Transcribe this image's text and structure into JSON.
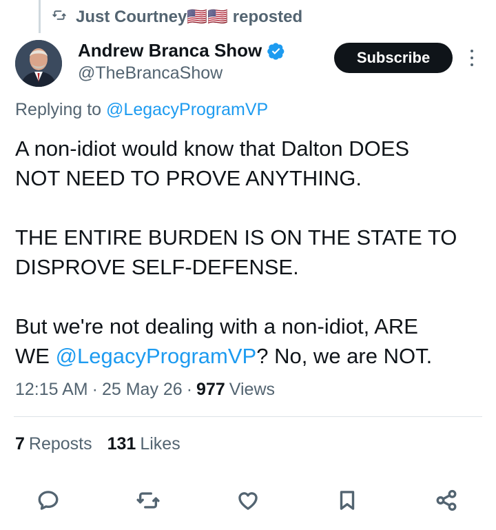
{
  "repost_header": {
    "user": "Just Courtney🇺🇸🇺🇸",
    "action": "reposted"
  },
  "author": {
    "name": "Andrew Branca Show",
    "handle": "@TheBrancaShow",
    "verified": true
  },
  "subscribe_label": "Subscribe",
  "replying": {
    "prefix": "Replying to",
    "mention": "@LegacyProgramVP"
  },
  "tweet": {
    "line1": "A non-idiot would know that Dalton DOES",
    "line2": "NOT NEED TO PROVE ANYTHING.",
    "line3": "THE ENTIRE BURDEN IS ON THE STATE TO",
    "line4": "DISPROVE SELF-DEFENSE.",
    "line5": "But we're not dealing with a non-idiot, ARE",
    "line6_prefix": "WE",
    "line6_mention": "@LegacyProgramVP",
    "line6_suffix": "? No, we are NOT."
  },
  "meta": {
    "time": "12:15 AM",
    "date": "25 May 26",
    "views_count": "977",
    "views_label": "Views"
  },
  "stats": {
    "reposts_count": "7",
    "reposts_label": "Reposts",
    "likes_count": "131",
    "likes_label": "Likes"
  },
  "colors": {
    "accent": "#1d9bf0",
    "text": "#0f1419",
    "secondary": "#536471",
    "button_bg": "#0f1419"
  },
  "icons": [
    "repost-icon",
    "verified-badge-icon",
    "more-icon",
    "reply-icon",
    "repost-action-icon",
    "like-icon",
    "bookmark-icon",
    "share-icon"
  ]
}
